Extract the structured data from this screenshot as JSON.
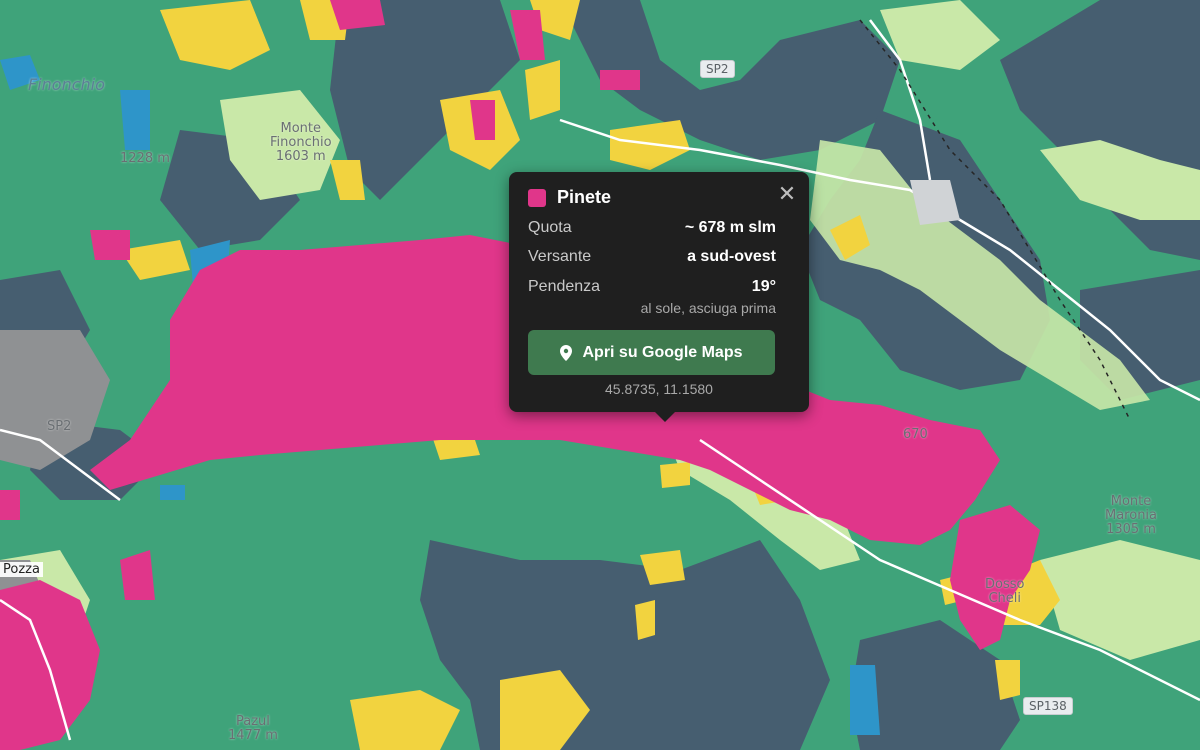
{
  "map": {
    "legend_colors": {
      "pinete": "#e0368a",
      "faggete": "#3fa37a",
      "abetine": "#465e70",
      "prati": "#c9e8a8",
      "coltivi": "#f2d33f",
      "acque": "#2e95c9",
      "rocce": "#8f8f8f"
    },
    "labels": {
      "finonchio": "Finonchio",
      "monte_finonchio_1": "Monte",
      "monte_finonchio_2": "Finonchio",
      "monte_finonchio_3": "1603 m",
      "peak_1228": "1228 m",
      "sp2_shield": "SP2",
      "sp2_left": "SP2",
      "sp138": "SP138",
      "pozza": "Pozza",
      "pazul_1": "Pazul",
      "pazul_2": "1477 m",
      "monte_maronia_1": "Monte",
      "monte_maronia_2": "Maronia",
      "monte_maronia_3": "1305 m",
      "dosso_1": "Dosso",
      "dosso_2": "Cheli",
      "elev_670": "670"
    }
  },
  "popup": {
    "title": "Pinete",
    "swatch_color": "#e0368a",
    "close_icon": "close-icon",
    "rows": [
      {
        "label": "Quota",
        "value": "~ 678 m slm"
      },
      {
        "label": "Versante",
        "value": "a sud-ovest"
      },
      {
        "label": "Pendenza",
        "value": "19°"
      }
    ],
    "note": "al sole, asciuga prima",
    "button_label": "Apri su Google Maps",
    "button_icon": "map-pin-icon",
    "coords": "45.8735, 11.1580"
  }
}
